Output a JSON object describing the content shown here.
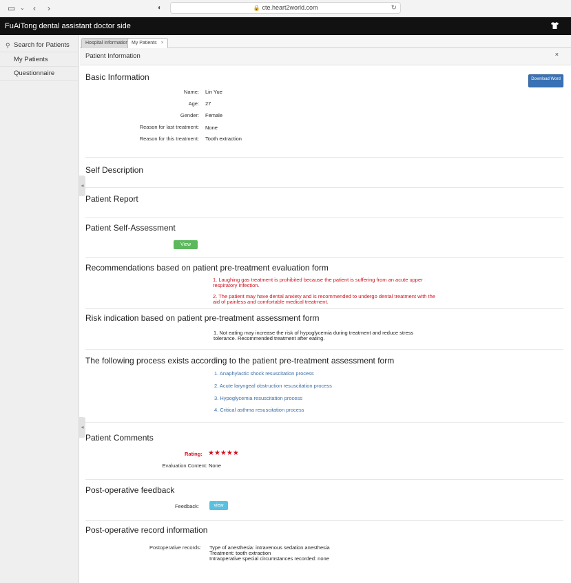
{
  "browser": {
    "url": "cte.heart2world.com"
  },
  "app": {
    "title": "FuAiTong dental assistant doctor side"
  },
  "sidebar": {
    "items": [
      {
        "label": "Search for Patients"
      },
      {
        "label": "My Patients"
      },
      {
        "label": "Questionnaire"
      }
    ]
  },
  "tabs": [
    {
      "label": "Hospital Information"
    },
    {
      "label": "My Patients"
    }
  ],
  "panel": {
    "title": "Patient Information",
    "close": "×"
  },
  "basic": {
    "title": "Basic Information",
    "download_label": "Download Word",
    "fields": [
      {
        "label": "Name:",
        "value": "Lin Yue"
      },
      {
        "label": "Age:",
        "value": "27"
      },
      {
        "label": "Gender:",
        "value": "Female"
      },
      {
        "label": "Reason for last treatment:",
        "value": "None"
      },
      {
        "label": "Reason for this treatment:",
        "value": "Tooth extraction"
      }
    ]
  },
  "self_description": {
    "title": "Self Description"
  },
  "patient_report": {
    "title": "Patient Report"
  },
  "self_assessment": {
    "title": "Patient Self-Assessment",
    "view_label": "View"
  },
  "recommendations": {
    "title": "Recommendations based on patient pre-treatment evaluation form",
    "items": [
      "1. Laughing gas treatment is prohibited because the patient is suffering from an acute upper respiratory infection.",
      "2. The patient may have dental anxiety and is recommended to undergo dental treatment with the aid of painless and comfortable medical treatment."
    ]
  },
  "risk": {
    "title": "Risk indication based on patient pre-treatment assessment form",
    "items": [
      "1. Not eating may increase the risk of hypoglycemia during treatment and reduce stress tolerance. Recommended treatment after eating."
    ]
  },
  "process": {
    "title": "The following process exists according to the patient pre-treatment assessment form",
    "items": [
      "1. Anaphylactic shock resuscitation process",
      "2. Acute laryngeal obstruction resuscitation process",
      "3. Hypoglycemia resuscitation process",
      "4. Critical asthma resuscitation process"
    ]
  },
  "comments": {
    "title": "Patient Comments",
    "rating_label": "Rating:",
    "rating": 5,
    "stars": "★★★★★",
    "evaluation_label": "Evaluation Content:",
    "evaluation_value": "None"
  },
  "feedback": {
    "title": "Post-operative feedback",
    "label": "Feedback:",
    "view_label": "view"
  },
  "records": {
    "title": "Post-operative record information",
    "label": "Postoperative records:",
    "lines": [
      "Type of anesthesia: intravenous sedation anesthesia",
      "Treatment: tooth extraction",
      "Intraoperative special circumstances recorded: none"
    ]
  },
  "colors": {
    "header_bg": "#111111",
    "accent_red": "#d0101c",
    "link_blue": "#3a6ea5",
    "button_blue": "#3871b5",
    "button_green": "#5cb85c",
    "button_cyan": "#5bc0de"
  }
}
